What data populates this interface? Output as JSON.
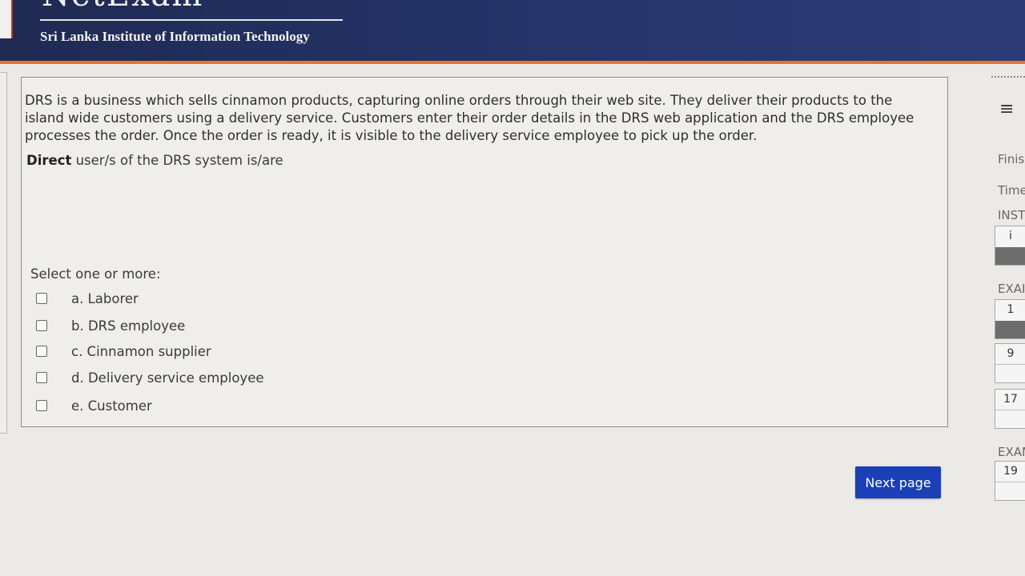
{
  "header": {
    "logo_word": "NetExam",
    "institute": "Sri Lanka Institute of Information Technology"
  },
  "question": {
    "text": "DRS is a business which sells cinnamon products, capturing online orders through their web site. They deliver their products to the island wide customers using a delivery service. Customers enter their order details in the DRS web application and the DRS employee processes the order. Once the order is ready, it is visible to the delivery service employee to pick up the order.",
    "prompt_bold": "Direct",
    "prompt_rest": " user/s of the DRS system is/are",
    "select_label": "Select one or more:",
    "answers": [
      {
        "label": "a. Laborer",
        "checked": false
      },
      {
        "label": "b. DRS employee",
        "checked": false
      },
      {
        "label": "c. Cinnamon supplier",
        "checked": false
      },
      {
        "label": "d. Delivery service employee",
        "checked": false
      },
      {
        "label": "e. Customer",
        "checked": false
      }
    ]
  },
  "navigation": {
    "next_label": "Next page"
  },
  "side_panel": {
    "menu_icon": "hamburger-menu-icon",
    "finish_label": "Finis",
    "time_label": "Time",
    "instructions_label": "INST",
    "info_tile": "i",
    "exam_label_1": "EXAI",
    "tiles": [
      "1",
      "9",
      "17"
    ],
    "exam_label_2": "EXAM",
    "tile_last": "19"
  },
  "colors": {
    "header_bg": "#26346a",
    "header_accent": "#e8742a",
    "next_button": "#1a3fb7"
  }
}
